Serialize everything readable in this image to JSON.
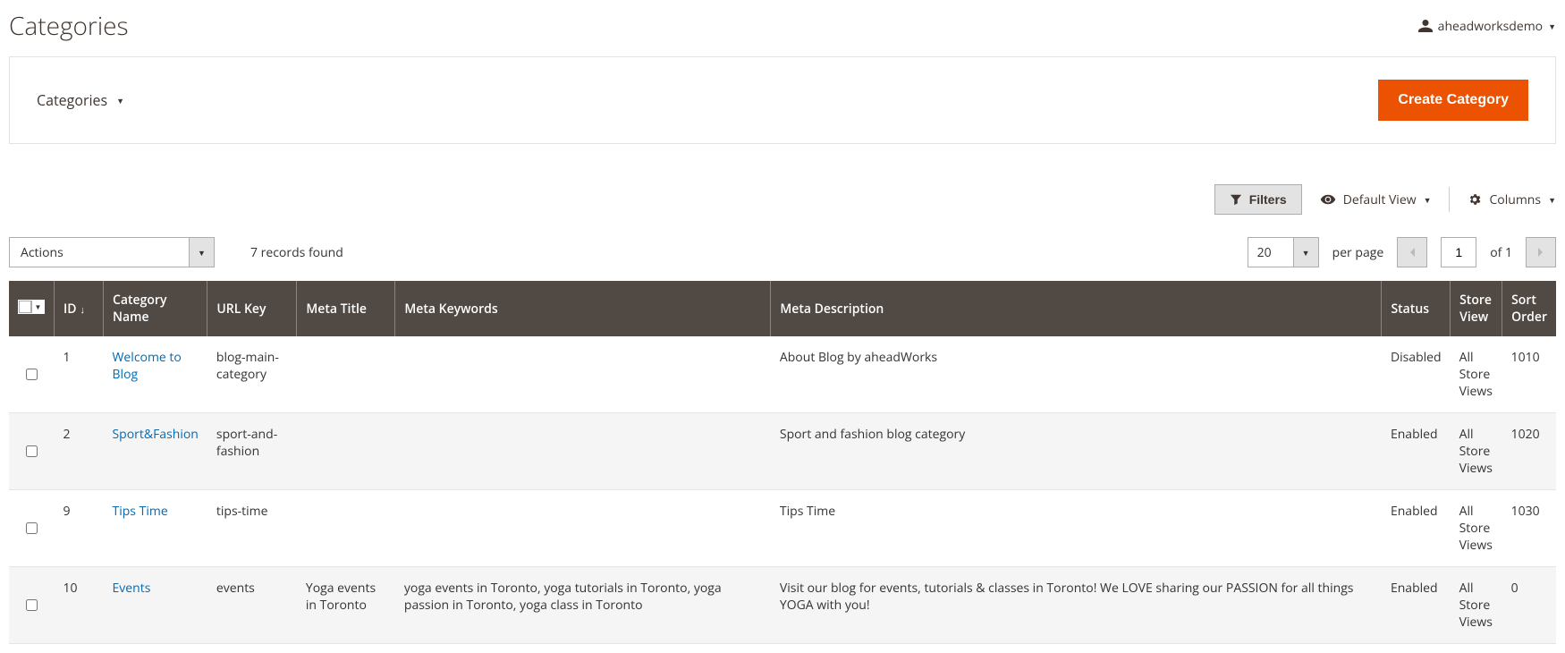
{
  "header": {
    "title": "Categories",
    "user": "aheadworksdemo"
  },
  "toolbar": {
    "dropdown_label": "Categories",
    "create_button": "Create Category"
  },
  "controls": {
    "filters": "Filters",
    "default_view": "Default View",
    "columns": "Columns"
  },
  "actions": {
    "label": "Actions",
    "records_found": "7 records found",
    "per_page_value": "20",
    "per_page_label": "per page",
    "current_page": "1",
    "of_label": "of 1"
  },
  "columns": [
    "",
    "ID",
    "Category Name",
    "URL Key",
    "Meta Title",
    "Meta Keywords",
    "Meta Description",
    "Status",
    "Store View",
    "Sort Order"
  ],
  "col_headers": {
    "id": "ID",
    "category_name": "Category Name",
    "url_key": "URL Key",
    "meta_title": "Meta Title",
    "meta_keywords": "Meta Keywords",
    "meta_description": "Meta Description",
    "status": "Status",
    "store_view": "Store View",
    "sort_order": "Sort Order"
  },
  "rows": [
    {
      "id": "1",
      "name": "Welcome to Blog",
      "url_key": "blog-main-category",
      "meta_title": "",
      "meta_keywords": "",
      "meta_description": "About Blog by aheadWorks",
      "status": "Disabled",
      "store_view": "All Store Views",
      "sort_order": "1010"
    },
    {
      "id": "2",
      "name": "Sport&Fashion",
      "url_key": "sport-and-fashion",
      "meta_title": "",
      "meta_keywords": "",
      "meta_description": "Sport and fashion blog category",
      "status": "Enabled",
      "store_view": "All Store Views",
      "sort_order": "1020"
    },
    {
      "id": "9",
      "name": "Tips Time",
      "url_key": "tips-time",
      "meta_title": "",
      "meta_keywords": "",
      "meta_description": "Tips Time",
      "status": "Enabled",
      "store_view": "All Store Views",
      "sort_order": "1030"
    },
    {
      "id": "10",
      "name": "Events",
      "url_key": "events",
      "meta_title": "Yoga events in Toronto",
      "meta_keywords": "yoga events in Toronto, yoga tutorials in Toronto, yoga passion in Toronto, yoga class in Toronto",
      "meta_description": "Visit our blog for events, tutorials & classes in Toronto! We LOVE sharing our PASSION for all things YOGA with you!",
      "status": "Enabled",
      "store_view": "All Store Views",
      "sort_order": "0"
    }
  ]
}
